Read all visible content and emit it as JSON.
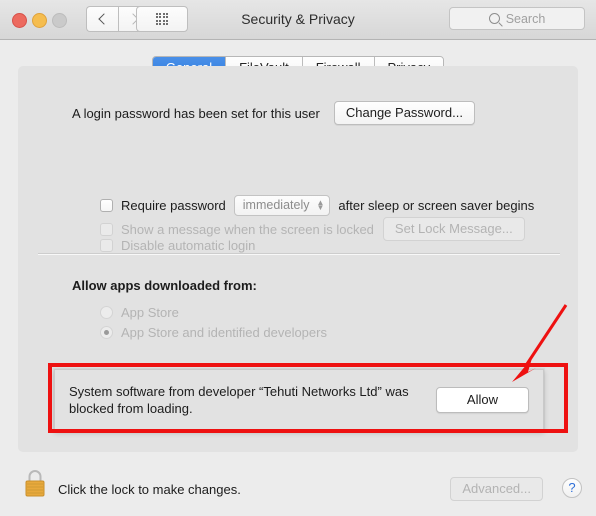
{
  "window": {
    "title": "Security & Privacy",
    "traffic_lights": [
      "close",
      "minimize",
      "zoom"
    ],
    "nav": {
      "back_icon": "chevron-left-icon",
      "forward_icon": "chevron-right-icon"
    },
    "grid_button_icon": "show-all-preferences-icon"
  },
  "search": {
    "placeholder": "Search",
    "icon": "search-icon"
  },
  "tabs": [
    {
      "label": "General",
      "active": true
    },
    {
      "label": "FileVault",
      "active": false
    },
    {
      "label": "Firewall",
      "active": false
    },
    {
      "label": "Privacy",
      "active": false
    }
  ],
  "general": {
    "login_password_text": "A login password has been set for this user",
    "change_password_label": "Change Password...",
    "require_password": {
      "label": "Require password",
      "checked": false,
      "enabled": true,
      "popup_value": "immediately",
      "suffix": "after sleep or screen saver begins"
    },
    "show_message": {
      "label": "Show a message when the screen is locked",
      "checked": false,
      "enabled": false,
      "button_label": "Set Lock Message..."
    },
    "disable_autologin": {
      "label": "Disable automatic login",
      "checked": false,
      "enabled": false
    },
    "allow_apps_label": "Allow apps downloaded from:",
    "radios": [
      {
        "label": "App Store",
        "selected": false,
        "enabled": false
      },
      {
        "label": "App Store and identified developers",
        "selected": true,
        "enabled": false
      }
    ]
  },
  "notice": {
    "message": "System software from developer “Tehuti Networks Ltd” was blocked from loading.",
    "allow_label": "Allow"
  },
  "annotation": {
    "color": "#ee1111",
    "shapes": [
      "rectangle",
      "arrow"
    ]
  },
  "footer": {
    "lock_icon": "closed-padlock-icon",
    "lock_text": "Click the lock to make changes.",
    "advanced_label": "Advanced...",
    "advanced_enabled": false,
    "help_label": "?"
  }
}
